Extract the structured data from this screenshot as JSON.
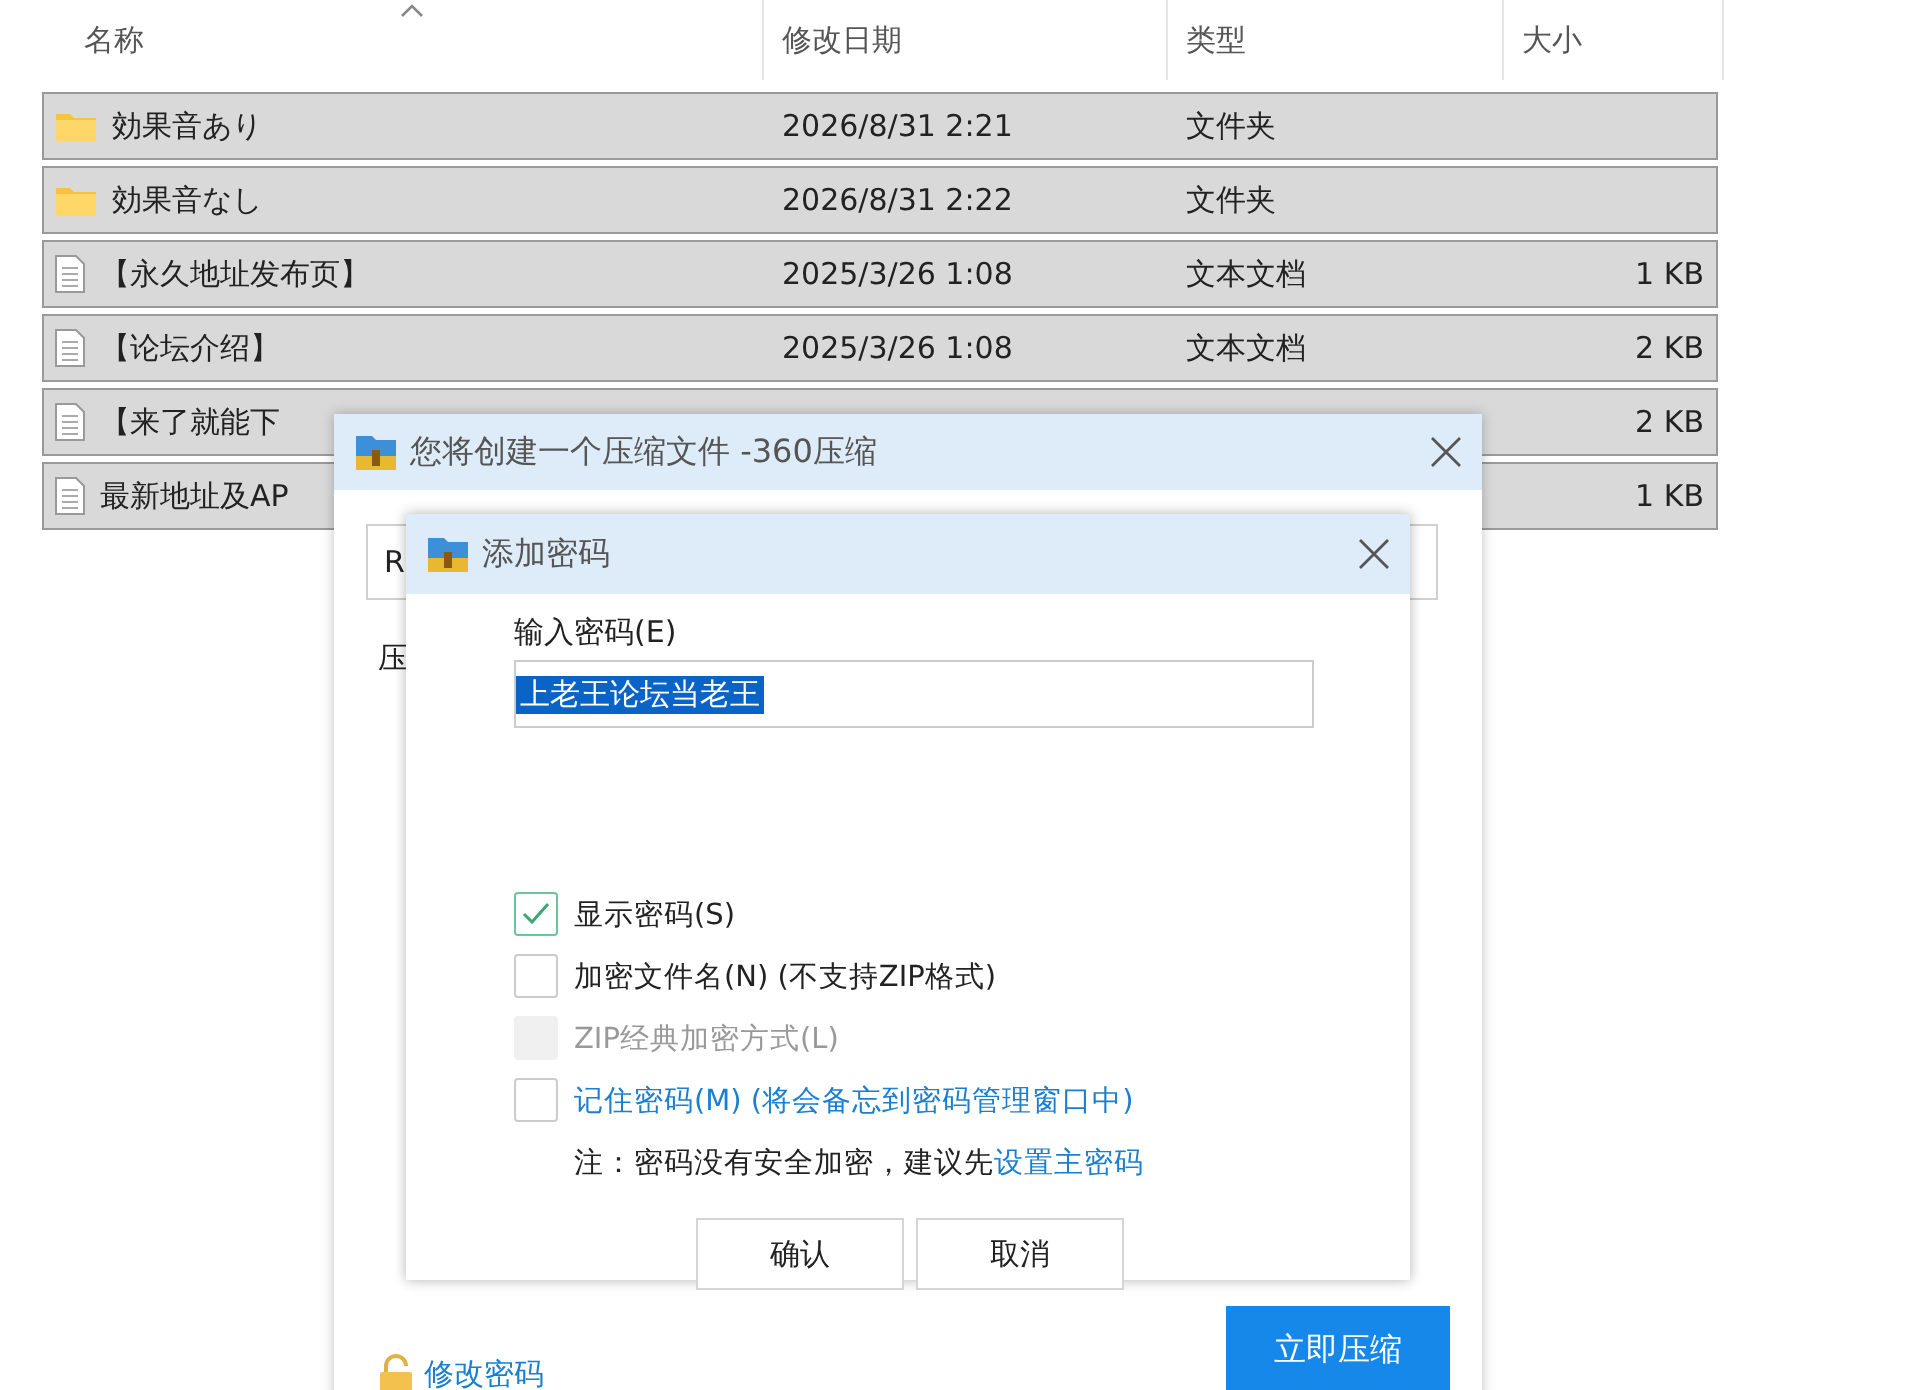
{
  "table": {
    "columns": [
      {
        "label": "名称",
        "sorted": true
      },
      {
        "label": "修改日期",
        "sorted": false
      },
      {
        "label": "类型",
        "sorted": false
      },
      {
        "label": "大小",
        "sorted": false
      }
    ],
    "rows": [
      {
        "kind": "folder",
        "name": "効果音あり",
        "date": "2026/8/31 2:21",
        "type": "文件夹",
        "selected": true
      },
      {
        "kind": "folder",
        "name": "効果音なし",
        "date": "2026/8/31 2:22",
        "type": "文件夹",
        "selected": true
      },
      {
        "kind": "file",
        "name": "【永久地址发布页】",
        "date": "2025/3/26 1:08",
        "type": "文本文档",
        "size": "1 KB",
        "selected": true
      },
      {
        "kind": "file",
        "name": "【论坛介绍】",
        "date": "2025/3/26 1:08",
        "type": "文本文档",
        "size": "2 KB",
        "selected": true
      },
      {
        "kind": "file",
        "name": "【来了就能下",
        "size": "2 KB",
        "selected": true
      },
      {
        "kind": "file",
        "name": "最新地址及AP",
        "size": "1 KB",
        "selected": true
      }
    ]
  },
  "compress_dialog": {
    "title": "您将创建一个压缩文件 -360压缩",
    "path_value": "R",
    "label": "压",
    "change_password": "修改密码",
    "compress_button": "立即压缩"
  },
  "password_dialog": {
    "title": "添加密码",
    "input_label": "输入密码(E)",
    "password": "上老王论坛当老王",
    "options": [
      {
        "label": "显示密码(S)",
        "checked": true,
        "disabled": false,
        "link": false
      },
      {
        "label": "加密文件名(N) (不支持ZIP格式)",
        "checked": false,
        "disabled": false,
        "link": false
      },
      {
        "label": "ZIP经典加密方式(L)",
        "checked": false,
        "disabled": true,
        "link": false
      },
      {
        "label": "记住密码(M) (将会备忘到密码管理窗口中)",
        "checked": false,
        "disabled": false,
        "link": true
      }
    ],
    "note": "注：密码没有安全加密，建议先",
    "note_link": "设置主密码",
    "buttons": [
      "确认",
      "取消"
    ]
  }
}
